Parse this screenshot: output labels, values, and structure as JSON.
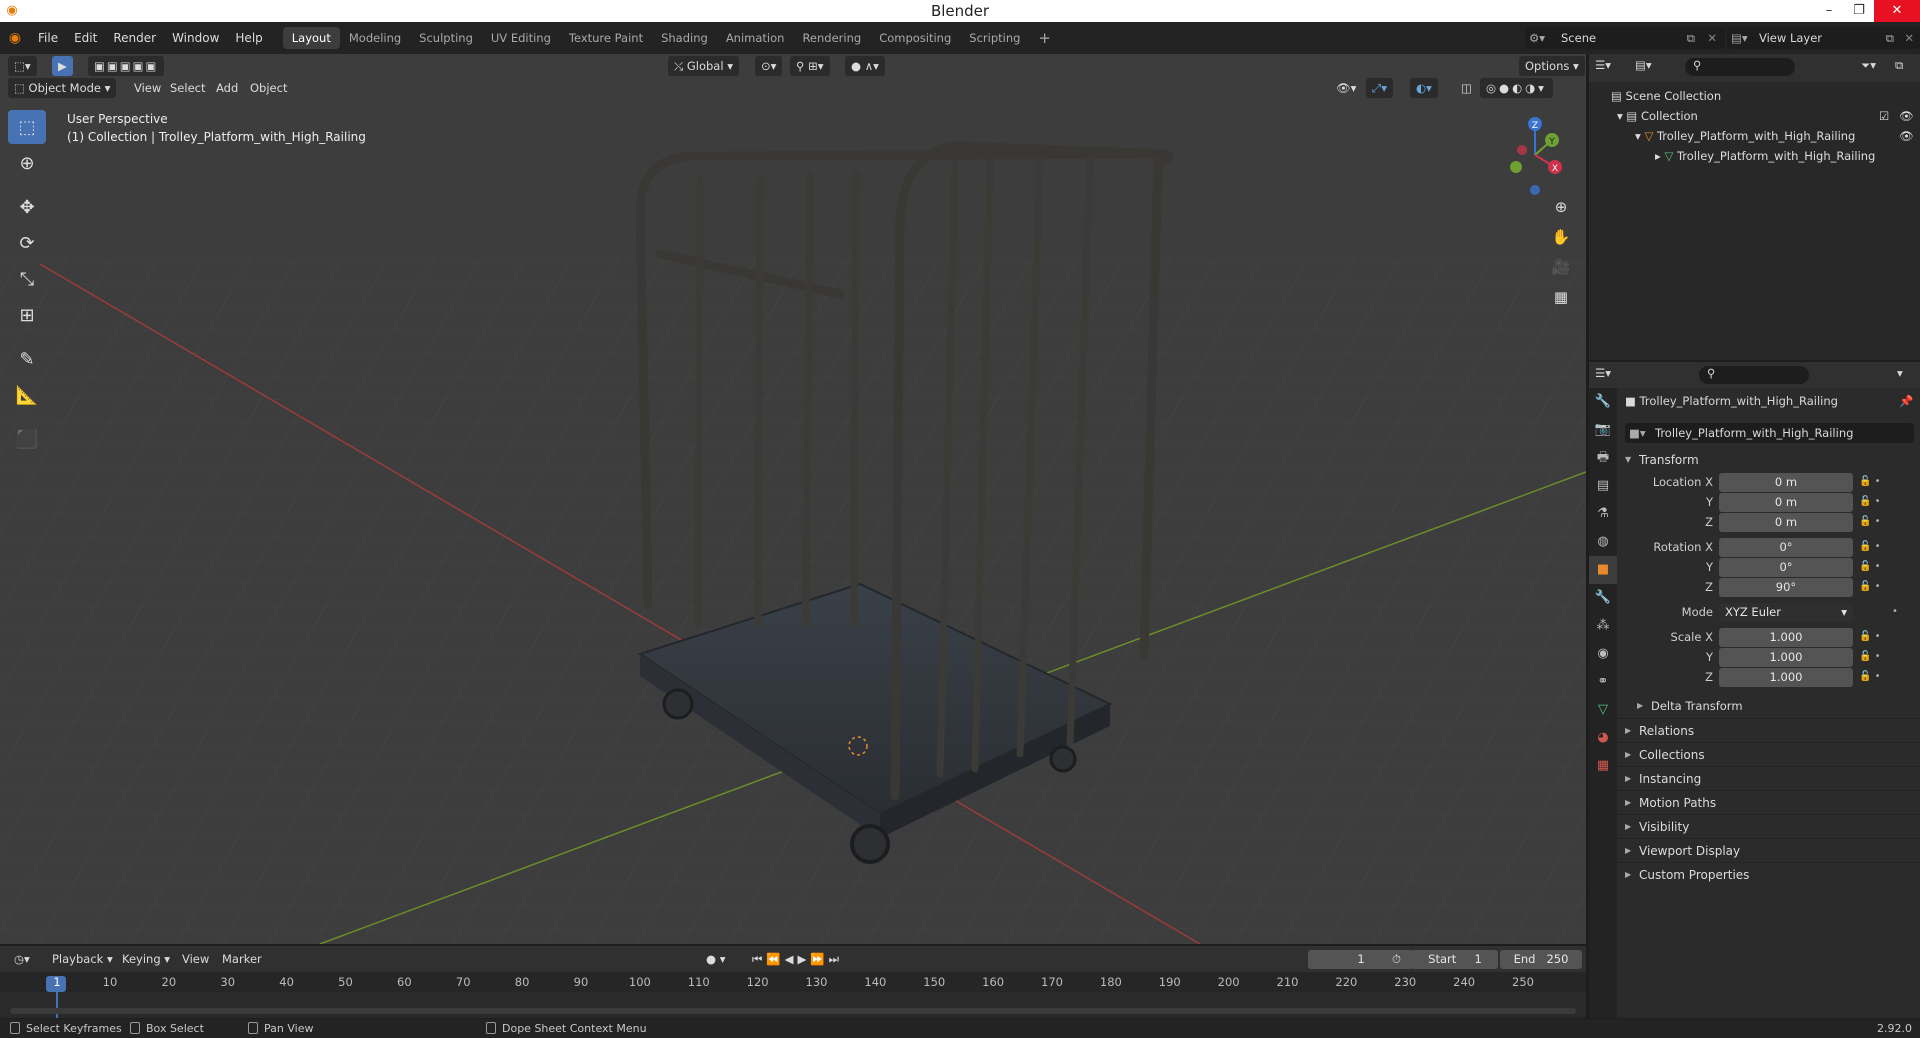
{
  "window": {
    "title": "Blender"
  },
  "menus": [
    "File",
    "Edit",
    "Render",
    "Window",
    "Help"
  ],
  "workspace_tabs": [
    "Layout",
    "Modeling",
    "Sculpting",
    "UV Editing",
    "Texture Paint",
    "Shading",
    "Animation",
    "Rendering",
    "Compositing",
    "Scripting"
  ],
  "active_workspace": "Layout",
  "scene": "Scene",
  "view_layer": "View Layer",
  "viewport": {
    "mode": "Object Mode",
    "menus": [
      "View",
      "Select",
      "Add",
      "Object"
    ],
    "orientation": "Global",
    "options_label": "Options",
    "info_line1": "User Perspective",
    "info_line2": "(1) Collection | Trolley_Platform_with_High_Railing"
  },
  "gizmo": {
    "x": "X",
    "y": "Y",
    "z": "Z"
  },
  "outliner": {
    "scene_collection": "Scene Collection",
    "collection": "Collection",
    "object": "Trolley_Platform_with_High_Railing",
    "mesh": "Trolley_Platform_with_High_Railing"
  },
  "properties": {
    "object_name": "Trolley_Platform_with_High_Railing",
    "datablock": "Trolley_Platform_with_High_Railing",
    "transform_label": "Transform",
    "location_label": "Location X",
    "rotation_label": "Rotation X",
    "scale_label": "Scale X",
    "y_label": "Y",
    "z_label": "Z",
    "mode_label": "Mode",
    "location": [
      "0 m",
      "0 m",
      "0 m"
    ],
    "rotation": [
      "0°",
      "0°",
      "90°"
    ],
    "mode": "XYZ Euler",
    "scale": [
      "1.000",
      "1.000",
      "1.000"
    ],
    "delta": "Delta Transform",
    "panels": [
      "Relations",
      "Collections",
      "Instancing",
      "Motion Paths",
      "Visibility",
      "Viewport Display",
      "Custom Properties"
    ]
  },
  "timeline": {
    "menus": [
      "Playback",
      "Keying",
      "View",
      "Marker"
    ],
    "current_frame": "1",
    "start_label": "Start",
    "start": "1",
    "end_label": "End",
    "end": "250",
    "ticks": [
      "1",
      "10",
      "20",
      "30",
      "40",
      "50",
      "60",
      "70",
      "80",
      "90",
      "100",
      "110",
      "120",
      "130",
      "140",
      "150",
      "160",
      "170",
      "180",
      "190",
      "200",
      "210",
      "220",
      "230",
      "240",
      "250"
    ]
  },
  "statusbar": {
    "select": "Select Keyframes",
    "box": "Box Select",
    "pan": "Pan View",
    "context": "Dope Sheet Context Menu",
    "version": "2.92.0"
  }
}
